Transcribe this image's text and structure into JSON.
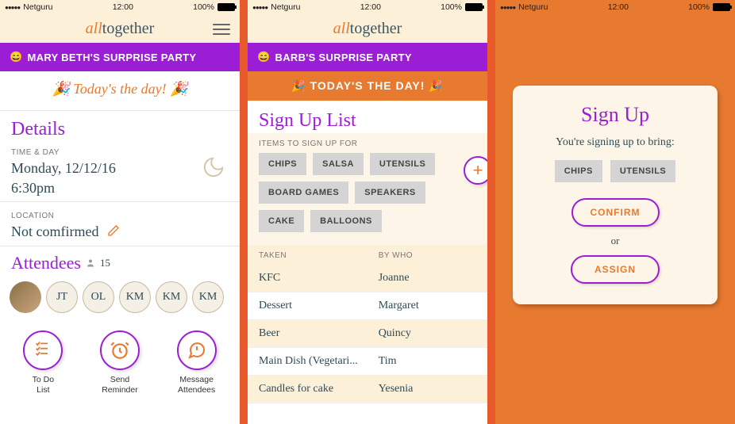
{
  "statusbar": {
    "carrier": "Netguru",
    "time": "12:00",
    "battery": "100%"
  },
  "logo": {
    "all": "all",
    "together": "together"
  },
  "screen1": {
    "banner_emoji": "😄",
    "banner_text": "MARY BETH'S SURPRISE PARTY",
    "today_text": "Today's the day!",
    "details_title": "Details",
    "timeday_label": "TIME & DAY",
    "date": "Monday, 12/12/16",
    "time": "6:30pm",
    "location_label": "LOCATION",
    "location_value": "Not comfirmed",
    "attendees_title": "Attendees",
    "attendees_count": "15",
    "avatars": [
      "",
      "JT",
      "OL",
      "KM",
      "KM",
      "KM"
    ],
    "actions": [
      {
        "label": "To Do\nList"
      },
      {
        "label": "Send\nReminder"
      },
      {
        "label": "Message\nAttendees"
      }
    ]
  },
  "screen2": {
    "banner_emoji": "😄",
    "banner_text": "BARB'S SURPRISE PARTY",
    "today_text": "TODAY'S THE DAY!",
    "title": "Sign Up List",
    "items_label": "ITEMS TO SIGN UP FOR",
    "chips": [
      "CHIPS",
      "SALSA",
      "UTENSILS",
      "BOARD GAMES",
      "SPEAKERS",
      "CAKE",
      "BALLOONS"
    ],
    "col_taken": "TAKEN",
    "col_bywho": "BY WHO",
    "rows": [
      {
        "taken": "KFC",
        "by": "Joanne"
      },
      {
        "taken": "Dessert",
        "by": "Margaret"
      },
      {
        "taken": "Beer",
        "by": "Quincy"
      },
      {
        "taken": "Main Dish (Vegetari...",
        "by": "Tim"
      },
      {
        "taken": "Candles for cake",
        "by": "Yesenia"
      }
    ]
  },
  "screen3": {
    "title": "Sign Up",
    "subtitle": "You're signing up to bring:",
    "chips": [
      "CHIPS",
      "UTENSILS"
    ],
    "confirm": "CONFIRM",
    "or": "or",
    "assign": "ASSIGN"
  }
}
